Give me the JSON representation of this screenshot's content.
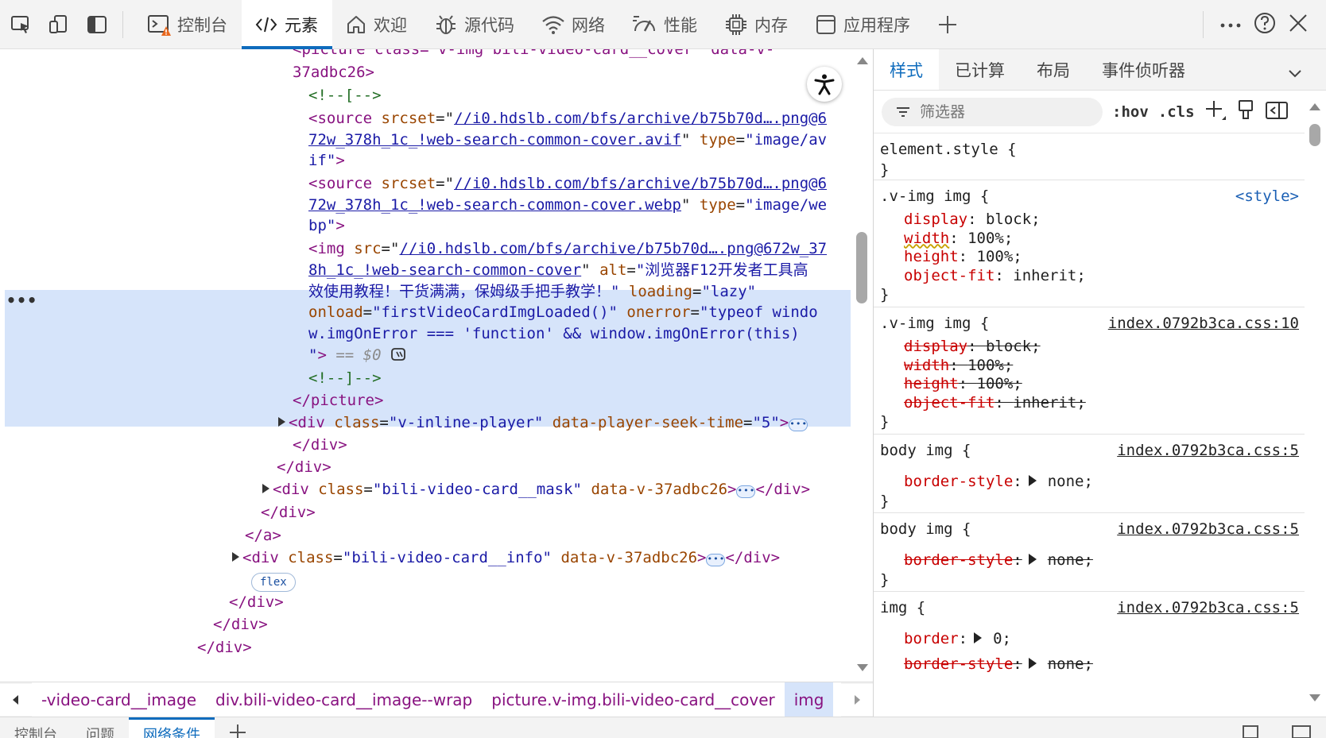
{
  "toolbar": {
    "tabs": [
      {
        "label": "控制台"
      },
      {
        "label": "元素"
      },
      {
        "label": "欢迎"
      },
      {
        "label": "源代码"
      },
      {
        "label": "网络"
      },
      {
        "label": "性能"
      },
      {
        "label": "内存"
      },
      {
        "label": "应用程序"
      }
    ]
  },
  "dom": {
    "l0_open": "<picture class=\"v-img bili-video-card__cover\" data-v-",
    "l1": "37adbc26>",
    "l2": "<!--[-->",
    "l3_tag": "<source",
    "l3_attr": "srcset",
    "l3_url": "//i0.hdslb.com/bfs/archive/b75b70d….png@6",
    "l4_url": "72w_378h_1c_!web-search-common-cover.avif",
    "l4_attr": "type",
    "l4_val": "\"image/av",
    "l5_val": "if\"",
    "l6_url": "//i0.hdslb.com/bfs/archive/b75b70d….png@6",
    "l7_url": "72w_378h_1c_!web-search-common-cover.webp",
    "l7_val": "\"image/we",
    "l8_val": "bp\"",
    "l9_tag": "<img",
    "l9_attr": "src",
    "l9_url": "//i0.hdslb.com/bfs/archive/b75b70d….png@672w_37",
    "l10_url": "8h_1c_!web-search-common-cover",
    "l10_attr": "alt",
    "l10_val": "\"浏览器F12开发者工具高",
    "l11_val": "效使用教程！干货满满，保姆级手把手教学！\"",
    "l11_attr": "loading",
    "l11_val2": "\"lazy\"",
    "l12_attr": "onload",
    "l12_val": "\"firstVideoCardImgLoaded()\"",
    "l12_attr2": "onerror",
    "l12_val2": "\"typeof windo",
    "l13_val": "w.imgOnError === 'function' && window.imgOnError(this)",
    "l14_val": "\"",
    "l14_ref": "== $0",
    "l15": "<!--]-->",
    "l16": "</picture>",
    "l17_tag": "<div",
    "l17_attr": "class",
    "l17_val": "\"v-inline-player\"",
    "l17_attr2": "data-player-seek-time",
    "l17_val2": "\"5\"",
    "l18": "</div>",
    "l19": "</div>",
    "l20_tag": "<div",
    "l20_attr": "class",
    "l20_val": "\"bili-video-card__mask\"",
    "l20_attr2": "data-v-37adbc26",
    "l20_close": "</div>",
    "l21": "</div>",
    "l22": "</a>",
    "l23_tag": "<div",
    "l23_attr": "class",
    "l23_val": "\"bili-video-card__info\"",
    "l23_attr2": "data-v-37adbc26",
    "l23_close": "</div>",
    "l24_badge": "flex",
    "l25": "</div>",
    "l26": "</div>",
    "l27": "</div>"
  },
  "breadcrumbs": [
    "-video-card__image",
    "div.bili-video-card__image--wrap",
    "picture.v-img.bili-video-card__cover",
    "img"
  ],
  "drawer": {
    "tabs": [
      "控制台",
      "问题",
      "网络条件"
    ]
  },
  "styles": {
    "tabs": [
      "样式",
      "已计算",
      "布局",
      "事件侦听器"
    ],
    "filter_placeholder": "筛选器",
    "hov": ":hov",
    "cls": ".cls",
    "rules": [
      {
        "selector": "element.style {",
        "source": "",
        "decls": []
      },
      {
        "selector": ".v-img img {",
        "source": "<style>",
        "decls": [
          {
            "name": "display",
            "value": "block;"
          },
          {
            "name": "width",
            "value": "100%;"
          },
          {
            "name": "height",
            "value": "100%;"
          },
          {
            "name": "object-fit",
            "value": "inherit;"
          }
        ]
      },
      {
        "selector": ".v-img img {",
        "source": "index.0792b3ca.css:10",
        "decls": [
          {
            "name": "display",
            "value": "block;"
          },
          {
            "name": "width",
            "value": "100%;"
          },
          {
            "name": "height",
            "value": "100%;"
          },
          {
            "name": "object-fit",
            "value": "inherit;"
          }
        ]
      },
      {
        "selector": "body img {",
        "source": "index.0792b3ca.css:5",
        "decls": [
          {
            "name": "border-style",
            "value": "none;"
          }
        ]
      },
      {
        "selector": "body img {",
        "source": "index.0792b3ca.css:5",
        "decls": [
          {
            "name": "border-style",
            "value": "none;"
          }
        ]
      },
      {
        "selector": "img {",
        "source": "index.0792b3ca.css:5",
        "decls": [
          {
            "name": "border",
            "value": "0;"
          },
          {
            "name": "border-style",
            "value": "none;"
          }
        ]
      }
    ],
    "close_brace": "}"
  }
}
